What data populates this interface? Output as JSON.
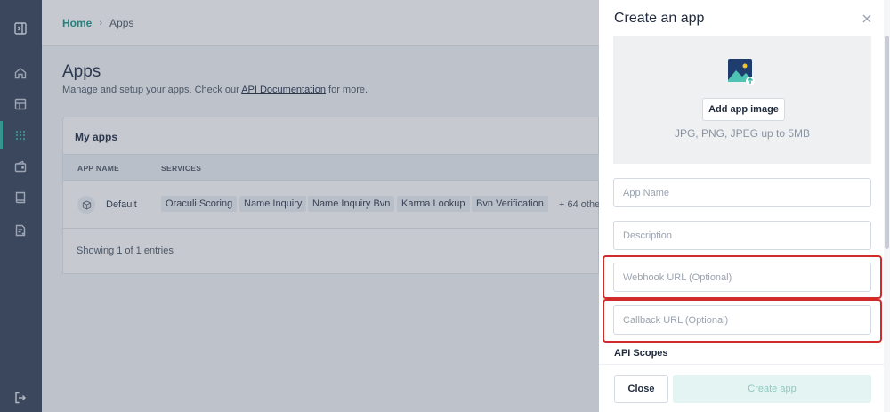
{
  "sidebar": {
    "items": [
      {
        "icon": "collapse-sidebar-icon"
      },
      {
        "icon": "home-icon"
      },
      {
        "icon": "dashboard-icon"
      },
      {
        "icon": "apps-grid-icon",
        "active": true
      },
      {
        "icon": "wallet-icon"
      },
      {
        "icon": "book-icon"
      },
      {
        "icon": "document-icon"
      },
      {
        "icon": "logout-icon"
      }
    ],
    "accent_color": "#39b8a8"
  },
  "breadcrumb": {
    "home": "Home",
    "separator": "›",
    "current": "Apps"
  },
  "page": {
    "title": "Apps",
    "subtitle_prefix": "Manage and setup your apps. Check our ",
    "subtitle_link": "API Documentation",
    "subtitle_suffix": " for more."
  },
  "apps_card": {
    "title": "My apps",
    "columns": [
      "APP NAME",
      "SERVICES"
    ],
    "rows": [
      {
        "name": "Default",
        "services": [
          "Oraculi Scoring",
          "Name Inquiry",
          "Name Inquiry Bvn",
          "Karma Lookup",
          "Bvn Verification"
        ],
        "more": "+ 64 othe"
      }
    ],
    "footer": "Showing 1 of 1 entries"
  },
  "panel": {
    "title": "Create an app",
    "upload": {
      "button": "Add app image",
      "hint": "JPG, PNG, JPEG up to 5MB"
    },
    "fields": {
      "app_name": "App Name",
      "description": "Description",
      "webhook": "Webhook URL (Optional)",
      "callback": "Callback URL (Optional)"
    },
    "scopes_label": "API Scopes",
    "close_button": "Close",
    "create_button": "Create app",
    "highlight_color": "#d12a2a"
  }
}
